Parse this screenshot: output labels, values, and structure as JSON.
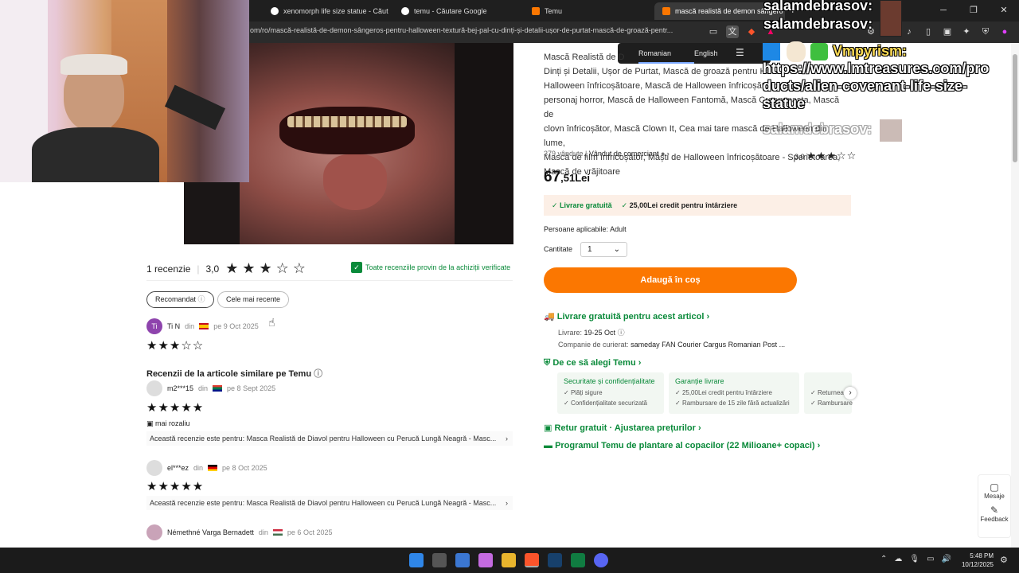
{
  "browser": {
    "tabs": [
      {
        "label": "xenomorph life size statue - Căutare"
      },
      {
        "label": "temu - Căutare Google"
      },
      {
        "label": "Temu"
      },
      {
        "label": "mască realistă de demon sângero"
      }
    ],
    "url": "om/ro/mască-realistă-de-demon-sângeros-pentru-halloween-textură-bej-pal-cu-dinți-și-detalii-ușor-de-purtat-mască-de-groază-pentr..."
  },
  "translate_popup": {
    "lang1": "Romanian",
    "lang2": "English"
  },
  "product": {
    "description_lines": [
      "Mască Realistă de D",
      "Dinți și Detalii, Ușor de Purtat, Mască de groază pentru Ha",
      "Halloween înfricoșătoare, Mască de Halloween înfricoșătoare, Mască de",
      "personaj horror, Mască de Halloween Fantomă, Mască Creepypasta, Mască de",
      "clovn înfricoșător, Mască Clown It, Cea mai tare mască de Halloween din lume,",
      "Mască de film înfricoșător, Măști de Halloween înfricoșătoare - Sperietoarea,",
      "Mască de vrăjitoare"
    ],
    "sold": "379 vândute",
    "seller": "Vândut de comerciant",
    "rating": "3,0",
    "price_int": "67",
    "price_dec": ",51Lei",
    "free_delivery": "Livrare gratuită",
    "credit": "25,00Lei credit pentru întârziere",
    "persons_label": "Persoane aplicabile:",
    "persons_value": "Adult",
    "qty_label": "Cantitate",
    "qty_value": "1",
    "add_to_cart": "Adaugă în coș",
    "free_delivery_article": "Livrare gratuită pentru acest articol",
    "delivery_label": "Livrare:",
    "delivery_dates": "19-25 Oct",
    "couriers_label": "Companie de curierat:",
    "couriers": "sameday  FAN Courier  Cargus  Romanian Post ...",
    "why_temu": "De ce să alegi Temu",
    "why_col1_title": "Securitate și confidențialitate",
    "why_col1_rows": [
      "Plăți sigure",
      "Confidențialitate securizată"
    ],
    "why_col2_title": "Garanție livrare",
    "why_col2_rows": [
      "25,00Lei credit pentru întârziere",
      "Rambursare de 15 zile fără actualizări"
    ],
    "why_col3_rows": [
      "Returnea",
      "Rambursare"
    ],
    "free_return": "Retur gratuit · Ajustarea prețurilor",
    "tree_program": "Programul Temu de plantare al copacilor (22 Milioane+ copaci)"
  },
  "reviews": {
    "count": "1 recenzie",
    "rating": "3,0",
    "verified": "Toate recenziile provin de la achiziții verificate",
    "sort_recommended": "Recomandat",
    "sort_recent": "Cele mai recente",
    "items": [
      {
        "initials": "Ti",
        "name": "Ti N",
        "from": "din",
        "date": "pe 9 Oct 2025",
        "stars": 3
      }
    ],
    "similar_title": "Recenzii de la articole similare pe Temu",
    "similar": [
      {
        "name": "m2***15",
        "from": "din",
        "date": "pe 8 Sept 2025",
        "stars": 5,
        "note": "mai rozaliu",
        "for": "Această recenzie este pentru: Masca Realistă de Diavol pentru Halloween cu Perucă Lungă Neagră - Masc..."
      },
      {
        "name": "el***ez",
        "from": "din",
        "date": "pe 8 Oct 2025",
        "stars": 5,
        "for": "Această recenzie este pentru: Masca Realistă de Diavol pentru Halloween cu Perucă Lungă Neagră - Masc..."
      },
      {
        "name": "Némethné Varga Bernadett",
        "from": "din",
        "date": "pe 6 Oct 2025"
      }
    ]
  },
  "side_widget": {
    "messages": "Mesaje",
    "feedback": "Feedback"
  },
  "overlay": {
    "chat1": "salamdebrasov:",
    "chat2": "salamdebrasov:",
    "vampyrism": "Vmpyrism:",
    "link_line1": "https://www.lmtreasures.com/pro",
    "link_line2": "ducts/alien-covenant-life-size-",
    "link_line3": "statue",
    "chat3": "salamdebrasov:"
  },
  "taskbar": {
    "time": "5:48 PM",
    "date": "10/12/2025"
  },
  "colors": {
    "accent": "#fb7701",
    "green": "#0a8a3a"
  }
}
